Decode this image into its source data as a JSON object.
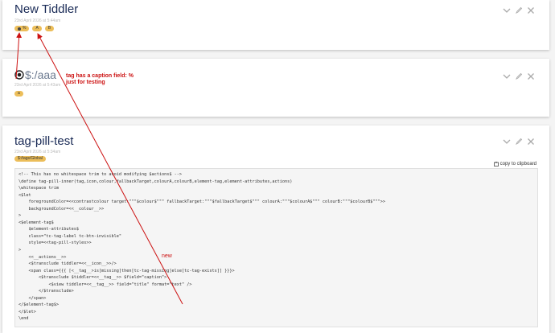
{
  "tiddlers": [
    {
      "title": "New Tiddler",
      "subtitle": "23rd April 2026 at 5:44am",
      "tags": [
        {
          "label": "%",
          "has_dot": true
        },
        {
          "label": "A"
        },
        {
          "label": "B"
        }
      ]
    },
    {
      "title": "$:/aaa",
      "subtitle": "23rd April 2026 at 5:43am",
      "tags": [
        {
          "label": "a"
        }
      ]
    },
    {
      "title": "tag-pill-test",
      "subtitle": "23rd April 2026 at 5:34am",
      "tags": [
        {
          "label": "$:/tags/Global"
        }
      ],
      "copy_label": "copy to clipboard",
      "code_lines": [
        "<!-- This has no whitespace trim to avoid modifying $actions$ -->",
        "\\define tag-pill-inner(tag,icon,colour,fallbackTarget,colourA,colourB,element-tag,element-attributes,actions)",
        "\\whitespace trim",
        "<$let",
        "    foregroundColor=<<contrastcolour target:\"\"\"$colour$\"\"\" fallbackTarget:\"\"\"$fallbackTarget$\"\"\" colourA:\"\"\"$colourA$\"\"\" colourB:\"\"\"$colourB$\"\"\">>",
        "    backgroundColor=<<__colour__>>",
        ">",
        "<$element-tag$",
        "    $element-attributes$",
        "    class=\"tc-tag-label tc-btn-invisible\"",
        "    style=<<tag-pill-styles>>",
        ">",
        "    <<__actions__>>",
        "    <$transclude tiddler=<<__icon__>>/>",
        "    <span class={{{ [<__tag__>is[missing]then[tc-tag-missing]else[tc-tag-exists]] }}}>",
        "        <$transclude $tiddler=<<__tag__>> $field=\"caption\">",
        "            <$view tiddler=<<__tag__>> field=\"title\" format=\"text\" />",
        "        </$transclude>",
        "    </span>",
        "</$element-tag$>",
        "</$let>",
        "\\end"
      ]
    }
  ],
  "annotations": {
    "caption_note": [
      "tag has a caption field: %",
      "just for testing"
    ],
    "new_note": "new"
  },
  "colors": {
    "annotation": "#cc1111",
    "tag_bg": "#ecbe5a",
    "title": "#182955"
  }
}
